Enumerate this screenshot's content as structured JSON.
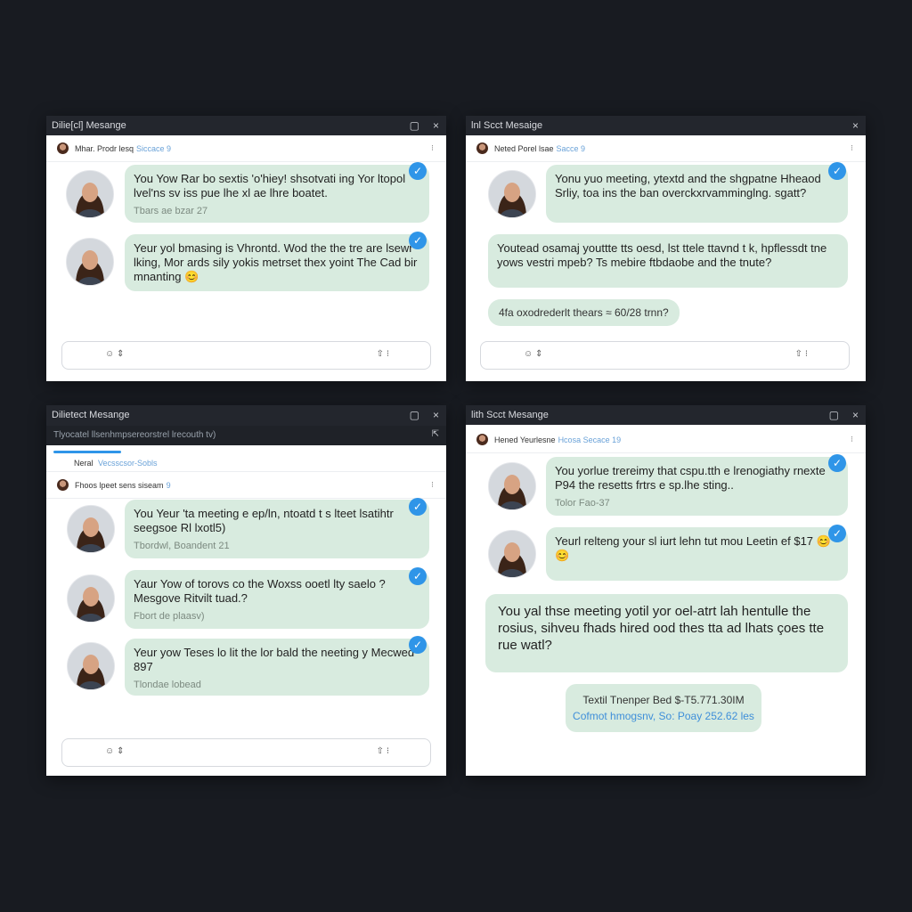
{
  "window_controls": {
    "maximize_icon": "▢",
    "close_icon": "×"
  },
  "windows": [
    {
      "title": "Dilie[cl] Mesange",
      "header": {
        "name": "Mhar. Prodr lesq",
        "sub": "Siccace 9",
        "more": "⁝"
      },
      "messages": [
        {
          "text": "You Yow Rar bo sextis 'o'hiey! shsotvati ing Yor ltopol lvel'ns sv iss pue lhe xl ae lhre boatet.",
          "time": "Tbars ae bzar 27"
        },
        {
          "text": "Yeur yol bmasing is Vhrontd. Wod the the tre are lsewr lking, Mor ards sily yokis metrset thex yoint The Cad bir mnanting 😊",
          "time": ""
        }
      ],
      "input": {
        "left": "☺ ⇕",
        "right": "⇧ ⁝"
      }
    },
    {
      "title": "lnl Scct Mesaige",
      "header": {
        "name": "Neted Porel lsae",
        "sub": "Sacce 9",
        "more": "⁝"
      },
      "messages": [
        {
          "text": "Yonu yuo meeting, ytextd and the shgpatne Hheaod Srliy, toa ins the ban overckxrvamminglng. sgatt?",
          "time": ""
        },
        {
          "text": "Youtead osamaj youttte tts oesd, lst ttele ttavnd t k, hpflessdt tne yows vestri mpeb? Ts mebire ftbdaobe and the tnute?",
          "time": ""
        }
      ],
      "pill": "4fa oxodrederlt thears ≈ 60/28 trnn?",
      "input": {
        "left": "☺ ⇕",
        "right": "⇧ ⁝"
      }
    },
    {
      "title": "Dilietect Mesange",
      "subtitle": "Tlyocatel llsenhmpsereorstrel lrecouth tv)",
      "sub_header": {
        "name": "Neral",
        "sub": "Vecsscsor-Sobls"
      },
      "header": {
        "name": "Fhoos lpeet sens siseam",
        "sub": "9",
        "more": "⁝"
      },
      "messages": [
        {
          "text": "You Yeur 'ta meeting e ep/ln, ntoatd t s lteet lsatihtr seegsoe Rl lxotl5)",
          "time": "Tbordwl, Boandent 21"
        },
        {
          "text": "Yaur Yow of torovs co the Woxss ooetl lty saelo ? Mesgove Ritvilt tuad.?",
          "time": "Fbort de plaasv)"
        },
        {
          "text": "Yeur yow Teses lo lit the lor bald the neeting y Mecwed 897",
          "time": "Tlondae lobead"
        }
      ],
      "input": {
        "left": "☺ ⇕",
        "right": "⇧ ⁝"
      }
    },
    {
      "title": "lith Scct Mesange",
      "header": {
        "name": "Hened Yeurlesne",
        "sub": "Hcosa Secace 19",
        "more": "⁝"
      },
      "messages": [
        {
          "text": "You yorlue trereimy that cspu.tth e lrenogiathy rnexte P94 the resetts frtrs e sp.lhe sting..",
          "time": "Tolor Fao-37"
        },
        {
          "text": "Yeurl relteng your sl iurt lehn tut mou Leetin ef $17 😊😊",
          "time": ""
        }
      ],
      "big_message": "You yal thse meeting yotil yor oel-atrt lah hentulle the rosius, sihveu fhads hired ood thes tta ad lhats çoes tte rue watl?",
      "info_pill": {
        "line1": "Textil Tnenper Bed $-T5.771.30IM",
        "line2": "Cofmot hmogsnv, So: Poay 252.62 les"
      }
    }
  ]
}
